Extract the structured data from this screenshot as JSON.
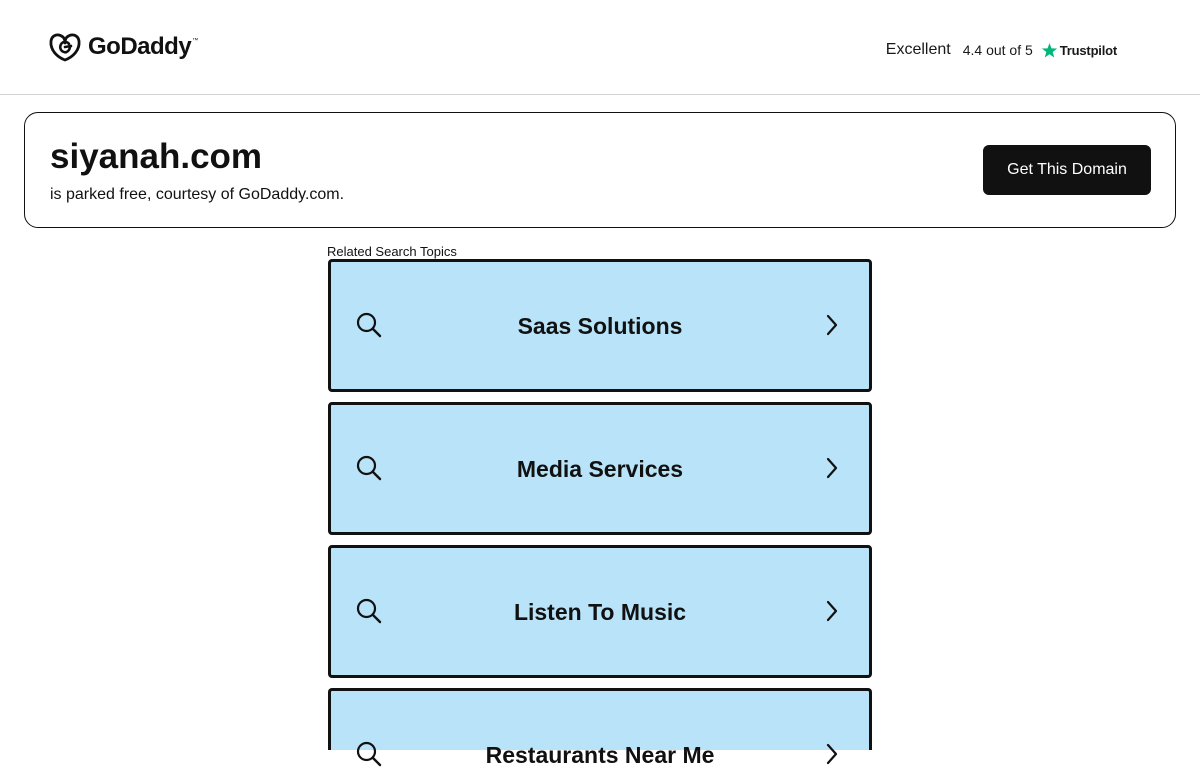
{
  "header": {
    "logo_text": "GoDaddy",
    "logo_tm": "™",
    "trust": {
      "rating_word": "Excellent",
      "score_text": "4.4 out of 5",
      "brand": "Trustpilot",
      "star_color": "#00b67a"
    }
  },
  "domain": {
    "name": "siyanah.com",
    "subtitle": "is parked free, courtesy of GoDaddy.com.",
    "cta_label": "Get This Domain"
  },
  "related": {
    "label": "Related Search Topics",
    "topics": [
      {
        "label": "Saas Solutions",
        "icon": "search-icon",
        "arrow": "chevron-right-icon"
      },
      {
        "label": "Media Services",
        "icon": "search-icon",
        "arrow": "chevron-right-icon"
      },
      {
        "label": "Listen To Music",
        "icon": "search-icon",
        "arrow": "chevron-right-icon"
      },
      {
        "label": "Restaurants Near Me",
        "icon": "search-icon",
        "arrow": "chevron-right-icon"
      }
    ]
  },
  "colors": {
    "topic_bg": "#b8e3f8",
    "button_bg": "#111111",
    "text": "#111111"
  }
}
